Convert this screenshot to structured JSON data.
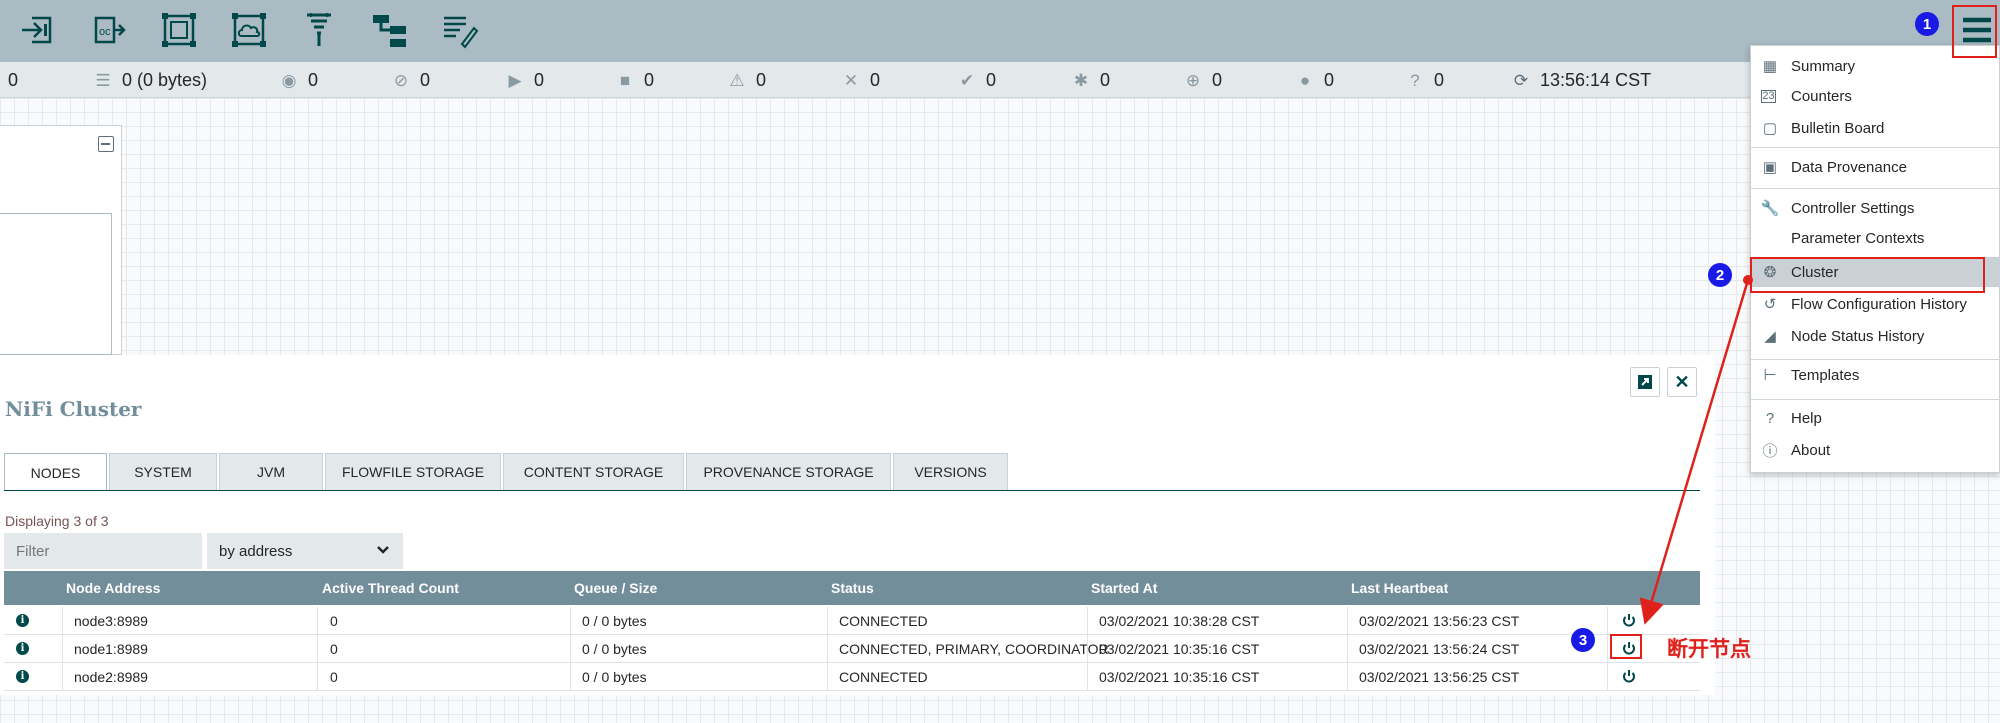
{
  "toolbar": {
    "icons": [
      "input-port-icon",
      "output-port-icon",
      "process-group-icon",
      "remote-process-group-icon",
      "funnel-icon",
      "template-icon",
      "label-icon"
    ],
    "menu_icon": "hamburger-menu-icon"
  },
  "status_bar": {
    "items": [
      {
        "icon": "thread-icon",
        "value": "0"
      },
      {
        "icon": "queue-icon",
        "value": "0 (0 bytes)"
      },
      {
        "icon": "transmitting-icon",
        "value": "0"
      },
      {
        "icon": "not-transmitting-icon",
        "value": "0"
      },
      {
        "icon": "running-icon",
        "value": "0"
      },
      {
        "icon": "stopped-icon",
        "value": "0"
      },
      {
        "icon": "invalid-icon",
        "value": "0"
      },
      {
        "icon": "disabled-icon",
        "value": "0"
      },
      {
        "icon": "up-to-date-icon",
        "value": "0"
      },
      {
        "icon": "locally-modified-icon",
        "value": "0"
      },
      {
        "icon": "stale-icon",
        "value": "0"
      },
      {
        "icon": "locally-modified-stale-icon",
        "value": "0"
      },
      {
        "icon": "sync-failure-icon",
        "value": "0"
      }
    ],
    "refresh_time": "13:56:14 CST"
  },
  "dialog": {
    "title": "NiFi Cluster",
    "tabs": [
      "NODES",
      "SYSTEM",
      "JVM",
      "FLOWFILE STORAGE",
      "CONTENT STORAGE",
      "PROVENANCE STORAGE",
      "VERSIONS"
    ],
    "active_tab": "NODES",
    "displaying": "Displaying 3 of 3",
    "filter_placeholder": "Filter",
    "filter_by": "by address",
    "columns": [
      "Node Address",
      "Active Thread Count",
      "Queue / Size",
      "Status",
      "Started At",
      "Last Heartbeat"
    ],
    "rows": [
      {
        "address": "node3:8989",
        "threads": "0",
        "queue": "0 / 0 bytes",
        "status": "CONNECTED",
        "started": "03/02/2021 10:38:28 CST",
        "heartbeat": "03/02/2021 13:56:23 CST"
      },
      {
        "address": "node1:8989",
        "threads": "0",
        "queue": "0 / 0 bytes",
        "status": "CONNECTED, PRIMARY, COORDINATOR",
        "started": "03/02/2021 10:35:16 CST",
        "heartbeat": "03/02/2021 13:56:24 CST"
      },
      {
        "address": "node2:8989",
        "threads": "0",
        "queue": "0 / 0 bytes",
        "status": "CONNECTED",
        "started": "03/02/2021 10:35:16 CST",
        "heartbeat": "03/02/2021 13:56:25 CST"
      }
    ]
  },
  "menu": {
    "items": [
      {
        "label": "Summary",
        "icon": "table-icon"
      },
      {
        "label": "Counters",
        "icon": "counter-icon"
      },
      {
        "label": "Bulletin Board",
        "icon": "sticky-note-icon"
      },
      {
        "label": "Data Provenance",
        "icon": "provenance-icon"
      },
      {
        "label": "Controller Settings",
        "icon": "wrench-icon"
      },
      {
        "label": "Parameter Contexts",
        "icon": ""
      },
      {
        "label": "Cluster",
        "icon": "cluster-icon"
      },
      {
        "label": "Flow Configuration History",
        "icon": "history-icon"
      },
      {
        "label": "Node Status History",
        "icon": "area-chart-icon"
      },
      {
        "label": "Templates",
        "icon": "template-icon"
      },
      {
        "label": "Help",
        "icon": "question-circle-icon"
      },
      {
        "label": "About",
        "icon": "info-circle-icon"
      }
    ],
    "selected": "Cluster"
  },
  "annotations": {
    "step1": "1",
    "step2": "2",
    "step3": "3",
    "note": "断开节点"
  },
  "colors": {
    "toolbar_bg": "#aabbc3",
    "table_header": "#728e9b",
    "annotation_red": "#e0201a",
    "annotation_blue": "#1a1ae6"
  }
}
